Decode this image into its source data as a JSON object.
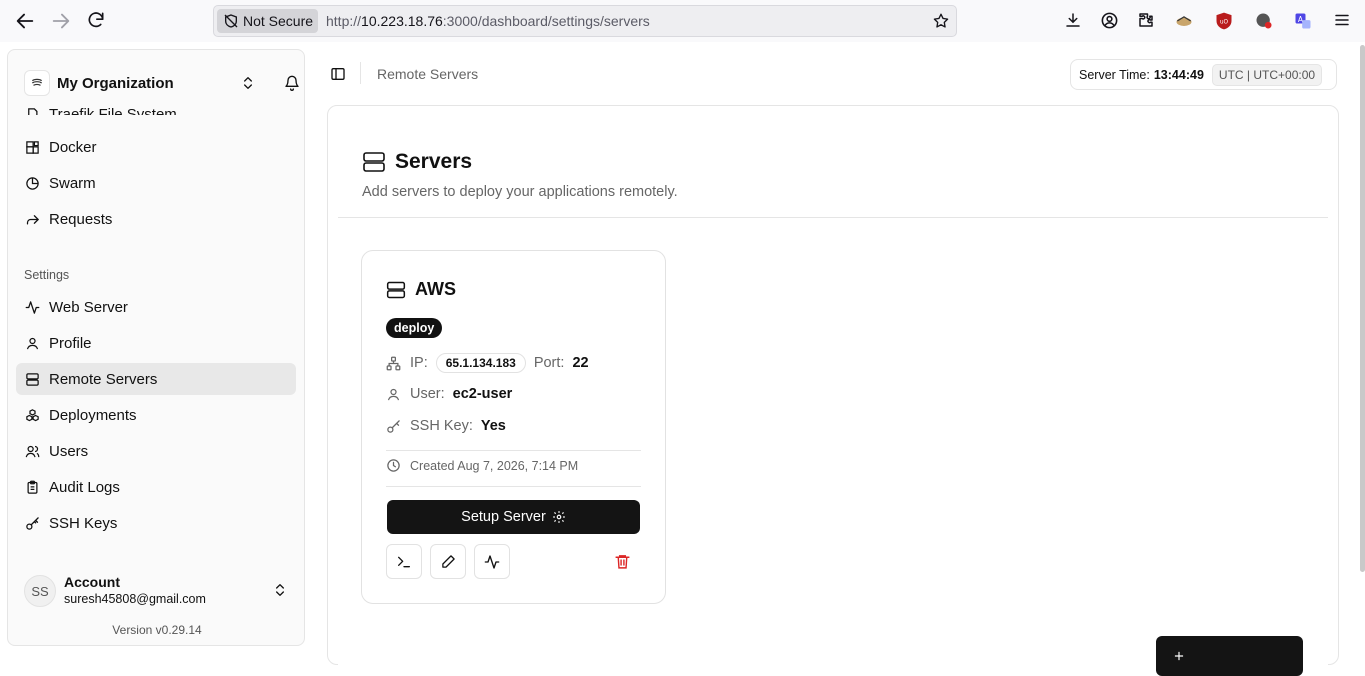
{
  "browser": {
    "security_label": "Not Secure",
    "url_prefix": "http://",
    "url_host": "10.223.18.76",
    "url_rest": ":3000/dashboard/settings/servers"
  },
  "sidebar": {
    "org_name": "My Organization",
    "items_top": [
      {
        "label": "Traefik File System",
        "icon": "file-icon"
      },
      {
        "label": "Docker",
        "icon": "blocks-icon"
      },
      {
        "label": "Swarm",
        "icon": "pie-chart-icon"
      },
      {
        "label": "Requests",
        "icon": "forward-arrow-icon"
      }
    ],
    "settings_label": "Settings",
    "items_settings": [
      {
        "label": "Web Server",
        "icon": "activity-icon"
      },
      {
        "label": "Profile",
        "icon": "user-icon"
      },
      {
        "label": "Remote Servers",
        "icon": "server-icon",
        "active": true
      },
      {
        "label": "Deployments",
        "icon": "boxes-icon"
      },
      {
        "label": "Users",
        "icon": "users-icon"
      },
      {
        "label": "Audit Logs",
        "icon": "clipboard-icon"
      },
      {
        "label": "SSH Keys",
        "icon": "key-icon"
      }
    ],
    "account": {
      "initials": "SS",
      "name": "Account",
      "email": "suresh45808@gmail.com"
    },
    "version": "Version v0.29.14"
  },
  "header": {
    "breadcrumb": "Remote Servers",
    "server_time_label": "Server Time:",
    "server_time_value": "13:44:49",
    "timezone": "UTC | UTC+00:00"
  },
  "page": {
    "title": "Servers",
    "description": "Add servers to deploy your applications remotely."
  },
  "server": {
    "name": "AWS",
    "badge": "deploy",
    "ip_label": "IP:",
    "ip": "65.1.134.183",
    "port_label": "Port:",
    "port": "22",
    "user_label": "User:",
    "user": "ec2-user",
    "ssh_label": "SSH Key:",
    "ssh": "Yes",
    "created": "Created Aug 7, 2026, 7:14 PM",
    "setup_label": "Setup Server"
  },
  "colors": {
    "primary": "#141414",
    "danger": "#dc2626",
    "sidebar_active": "#e8e8e8"
  }
}
